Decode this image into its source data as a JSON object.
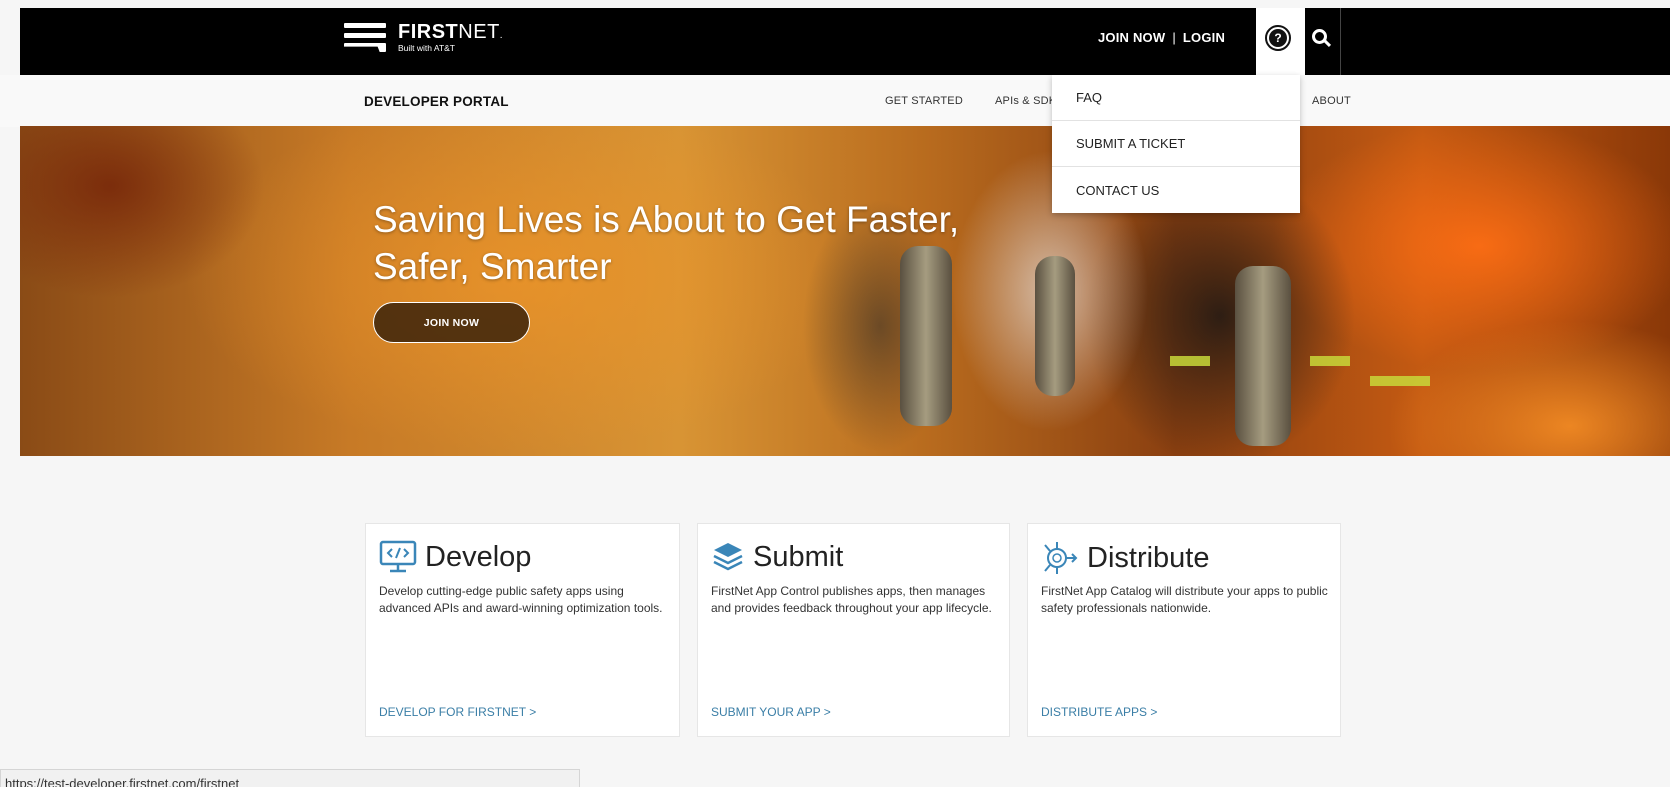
{
  "header": {
    "brand_bold": "FIRST",
    "brand_light": "NET",
    "brand_sub": "Built with AT&T",
    "join_label": "JOIN NOW",
    "separator": "|",
    "login_label": "LOGIN",
    "help_glyph": "?",
    "help_icon": "help-circle-icon",
    "search_icon": "search-icon"
  },
  "subnav": {
    "title": "DEVELOPER PORTAL",
    "items": [
      {
        "label": "GET STARTED"
      },
      {
        "label": "APIs & SDK"
      },
      {
        "label": "ABOUT"
      }
    ]
  },
  "dropdown": {
    "items": [
      {
        "label": "FAQ"
      },
      {
        "label": "SUBMIT A TICKET"
      },
      {
        "label": "CONTACT US"
      }
    ]
  },
  "hero": {
    "title_line1": "Saving Lives is About to Get Faster,",
    "title_line2": "Safer, Smarter",
    "button_label": "JOIN NOW"
  },
  "cards": [
    {
      "icon": "monitor-code-icon",
      "title": "Develop",
      "description": "Develop cutting-edge public safety apps using advanced APIs and award-winning optimization tools.",
      "link": "DEVELOP FOR FIRSTNET >"
    },
    {
      "icon": "stack-layers-icon",
      "title": "Submit",
      "description": "FirstNet App Control publishes apps, then manages and provides feedback throughout your app lifecycle.",
      "link": "SUBMIT YOUR APP >"
    },
    {
      "icon": "distribute-network-icon",
      "title": "Distribute",
      "description": "FirstNet App Catalog will distribute your apps to public safety professionals nationwide.",
      "link": "DISTRIBUTE APPS >"
    }
  ],
  "status_url": "https://test-developer.firstnet.com/firstnet",
  "colors": {
    "topbar": "#000000",
    "link": "#3a7ea6",
    "card_icon": "#3a86b8"
  }
}
